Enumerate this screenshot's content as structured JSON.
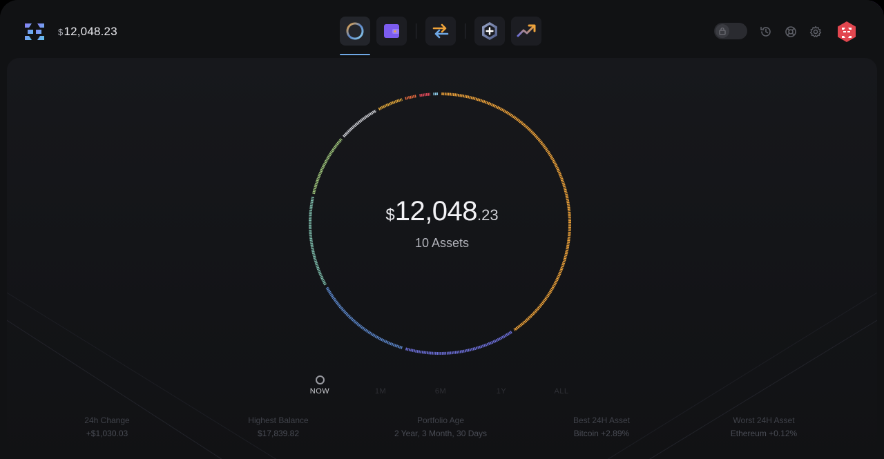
{
  "header": {
    "balance_currency": "$",
    "balance": "12,048.23",
    "nav": [
      {
        "name": "portfolio",
        "icon": "portfolio-ring-icon",
        "active": true
      },
      {
        "name": "wallet",
        "icon": "wallet-icon",
        "active": false
      },
      {
        "name": "exchange",
        "icon": "exchange-arrows-icon",
        "active": false
      },
      {
        "name": "add-app",
        "icon": "add-app-icon",
        "active": false
      },
      {
        "name": "trends",
        "icon": "trend-up-icon",
        "active": false
      }
    ],
    "tools": [
      "lock-toggle",
      "history-icon",
      "help-icon",
      "settings-icon",
      "avatar"
    ]
  },
  "portfolio": {
    "currency": "$",
    "whole": "12,048",
    "cents": ".23",
    "assets_label": "10 Assets"
  },
  "ring_segments": [
    {
      "color": "#f0a43a",
      "share": 0.405
    },
    {
      "color": "#6c6fd8",
      "share": 0.14
    },
    {
      "color": "#5b86c9",
      "share": 0.125
    },
    {
      "color": "#7bb9a8",
      "share": 0.115
    },
    {
      "color": "#9ec47b",
      "share": 0.08
    },
    {
      "color": "#cfd0d6",
      "share": 0.055
    },
    {
      "color": "#e0a63a",
      "share": 0.035
    },
    {
      "color": "#e56a3e",
      "share": 0.018
    },
    {
      "color": "#e04a5a",
      "share": 0.017
    },
    {
      "color": "#8fd0ee",
      "share": 0.01
    }
  ],
  "range_tabs": [
    {
      "label": "NOW",
      "active": true
    },
    {
      "label": "1M",
      "active": false
    },
    {
      "label": "6M",
      "active": false
    },
    {
      "label": "1Y",
      "active": false
    },
    {
      "label": "ALL",
      "active": false
    }
  ],
  "stats": [
    {
      "label": "24h Change",
      "value": "+$1,030.03"
    },
    {
      "label": "Highest Balance",
      "value": "$17,839.82"
    },
    {
      "label": "Portfolio Age",
      "value": "2 Year, 3 Month, 30 Days"
    },
    {
      "label": "Best 24H Asset",
      "value": "Bitcoin +2.89%"
    },
    {
      "label": "Worst 24H Asset",
      "value": "Ethereum +0.12%"
    }
  ],
  "colors": {
    "accent": "#6fa8e6",
    "brand_red": "#e2464f",
    "wallet_purple": "#7c5cf0",
    "exchange_orange": "#f0a43a"
  }
}
